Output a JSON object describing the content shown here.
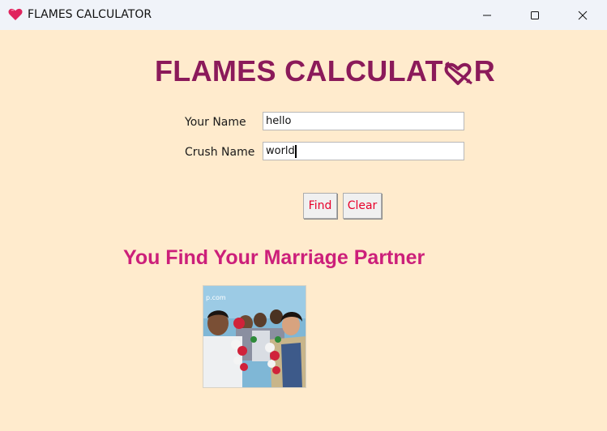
{
  "window": {
    "title": "FLAMES CALCULATOR",
    "icon": "heart-icon",
    "controls": [
      "minimize-icon",
      "maximize-icon",
      "close-icon"
    ]
  },
  "heading": {
    "text_before": "FLAMES CALCULAT",
    "text_after": "R",
    "inline_icon": "heart-arrow-icon",
    "color": "#8b1a5a"
  },
  "form": {
    "your_name_label": "Your Name",
    "your_name_value": "hello",
    "crush_name_label": "Crush Name",
    "crush_name_value": "world"
  },
  "buttons": {
    "find_label": "Find",
    "clear_label": "Clear",
    "text_color": "#e8002a"
  },
  "result": {
    "text": "You Find Your Marriage Partner",
    "color": "#cc1f7a"
  },
  "photo": {
    "watermark": "p.com"
  },
  "colors": {
    "background": "#ffebcd",
    "titlebar": "#f0f3f9"
  }
}
